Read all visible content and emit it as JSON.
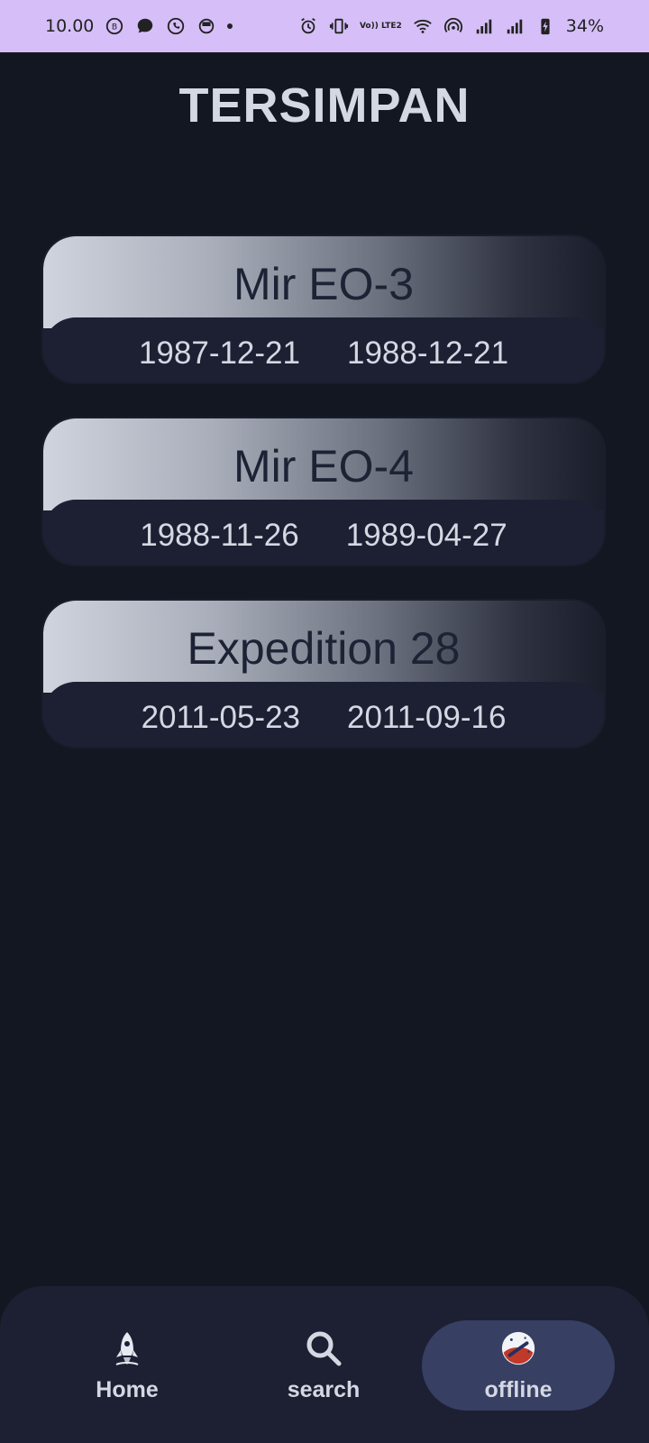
{
  "status_bar": {
    "time": "10.00",
    "network_badge": "Vo)) LTE2",
    "battery": "34%",
    "icons_left": [
      "b-badge-icon",
      "chat-bubble-icon",
      "whatsapp-icon",
      "circle-app-icon",
      "dot-icon"
    ],
    "icons_right": [
      "alarm-icon",
      "vibrate-icon",
      "wifi-icon",
      "hotspot-icon",
      "signal-icon",
      "signal-icon",
      "battery-charging-icon"
    ]
  },
  "page": {
    "title": "TERSIMPAN"
  },
  "cards": [
    {
      "name": "Mir EO-3",
      "start": "1987-12-21",
      "end": "1988-12-21"
    },
    {
      "name": "Mir EO-4",
      "start": "1988-11-26",
      "end": "1989-04-27"
    },
    {
      "name": "Expedition 28",
      "start": "2011-05-23",
      "end": "2011-09-16"
    }
  ],
  "nav": {
    "items": [
      {
        "label": "Home",
        "icon": "rocket-icon",
        "active": false
      },
      {
        "label": "search",
        "icon": "search-icon",
        "active": false
      },
      {
        "label": "offline",
        "icon": "space-badge-icon",
        "active": true
      }
    ]
  },
  "colors": {
    "background": "#131722",
    "status_bar": "#d6bff8",
    "card_body": "#1d2033",
    "nav_active": "#373f63",
    "text": "#d4d8e2"
  }
}
